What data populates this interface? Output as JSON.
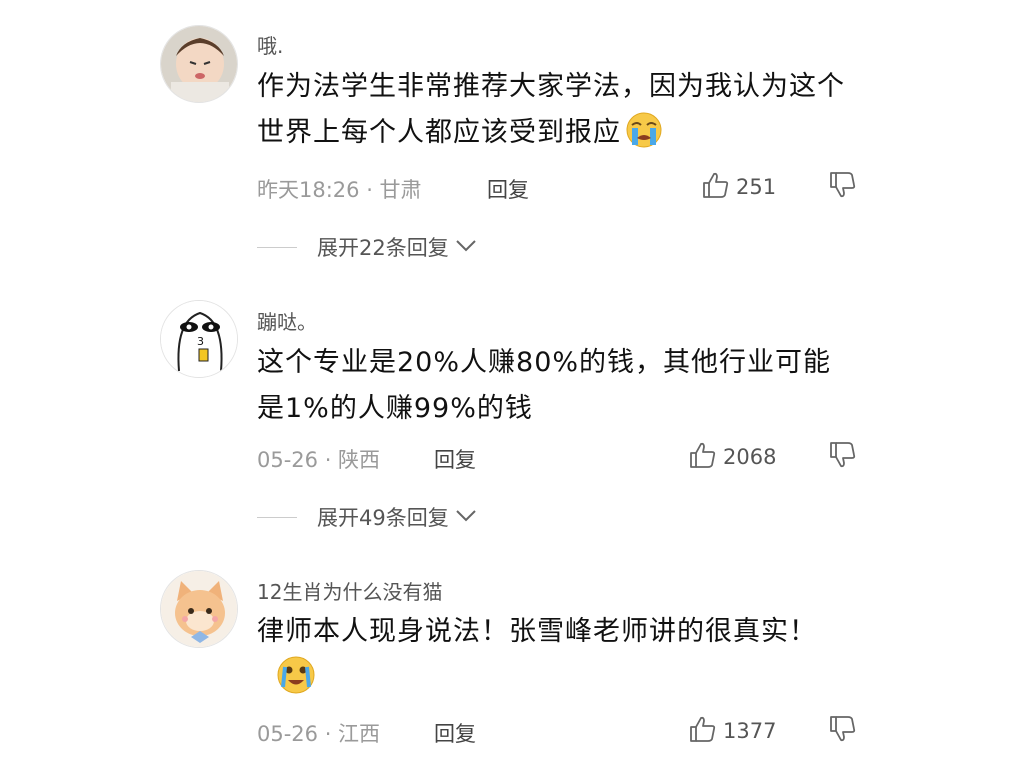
{
  "comments": [
    {
      "username": "哦.",
      "content": "作为法学生非常推荐大家学法，因为我认为这个世界上每个人都应该受到报应",
      "time_location": "昨天18:26 · 甘肃",
      "reply_label": "回复",
      "likes": "251",
      "expand_label": "展开22条回复",
      "emoji": "crying-face"
    },
    {
      "username": "蹦哒。",
      "content": "这个专业是20%人赚80%的钱，其他行业可能是1%的人赚99%的钱",
      "time_location": "05-26 · 陕西",
      "reply_label": "回复",
      "likes": "2068",
      "expand_label": "展开49条回复"
    },
    {
      "username": "12生肖为什么没有猫",
      "content": "律师本人现身说法！张雪峰老师讲的很真实！",
      "time_location": "05-26 · 江西",
      "reply_label": "回复",
      "likes": "1377",
      "emoji": "tearful-laugh-face"
    }
  ],
  "colors": {
    "text_primary": "#111111",
    "text_secondary": "#9a9a9a",
    "icon_gray": "#666666",
    "emoji_yellow": "#f7c948",
    "emoji_blue": "#4aa8e8"
  },
  "icons": {
    "like": "thumbs-up-icon",
    "dislike": "thumbs-down-icon",
    "expand": "chevron-down-icon"
  }
}
